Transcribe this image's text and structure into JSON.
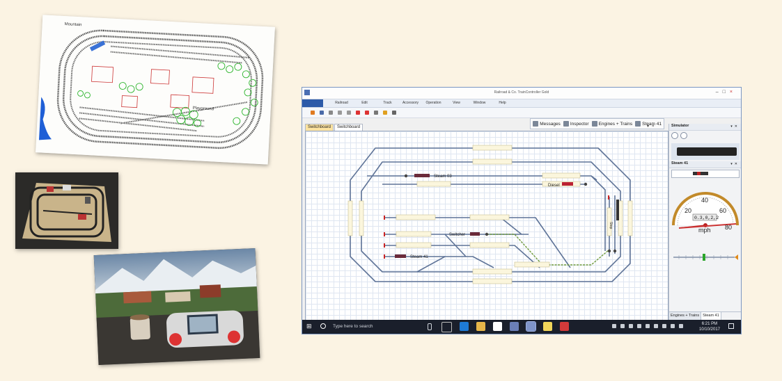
{
  "plan_photo": {
    "labels": [
      "Mountain",
      "Playground"
    ]
  },
  "app": {
    "title": "Railroad & Co. TrainController Gold",
    "menu": [
      "Railroad",
      "Edit",
      "Track",
      "Accessory",
      "Operation",
      "View",
      "Window",
      "Help"
    ],
    "panel_tabs": [
      "Messages",
      "Inspector",
      "Engines + Trains",
      "Steam 41"
    ],
    "doc_tabs": [
      "Switchboard",
      "Switchboard"
    ],
    "switchboard": {
      "labels": {
        "steam03": "Steam 03",
        "diesel": "Diesel",
        "switcher": "Switcher",
        "steam41": "Steam 41",
        "stop": "Stop"
      }
    },
    "dock": {
      "simulator_title": "Simulator",
      "engine_title": "Steam 41",
      "speed_display": "0.3,0,2,2",
      "speed_unit": "mph",
      "gauge_ticks": [
        "20",
        "40",
        "60",
        "80"
      ],
      "tabs": [
        "Engines + Trains",
        "Steam 41"
      ]
    },
    "taskbar": {
      "search_placeholder": "Type here to search",
      "time": "6:21 PM",
      "date": "10/10/2017"
    }
  }
}
